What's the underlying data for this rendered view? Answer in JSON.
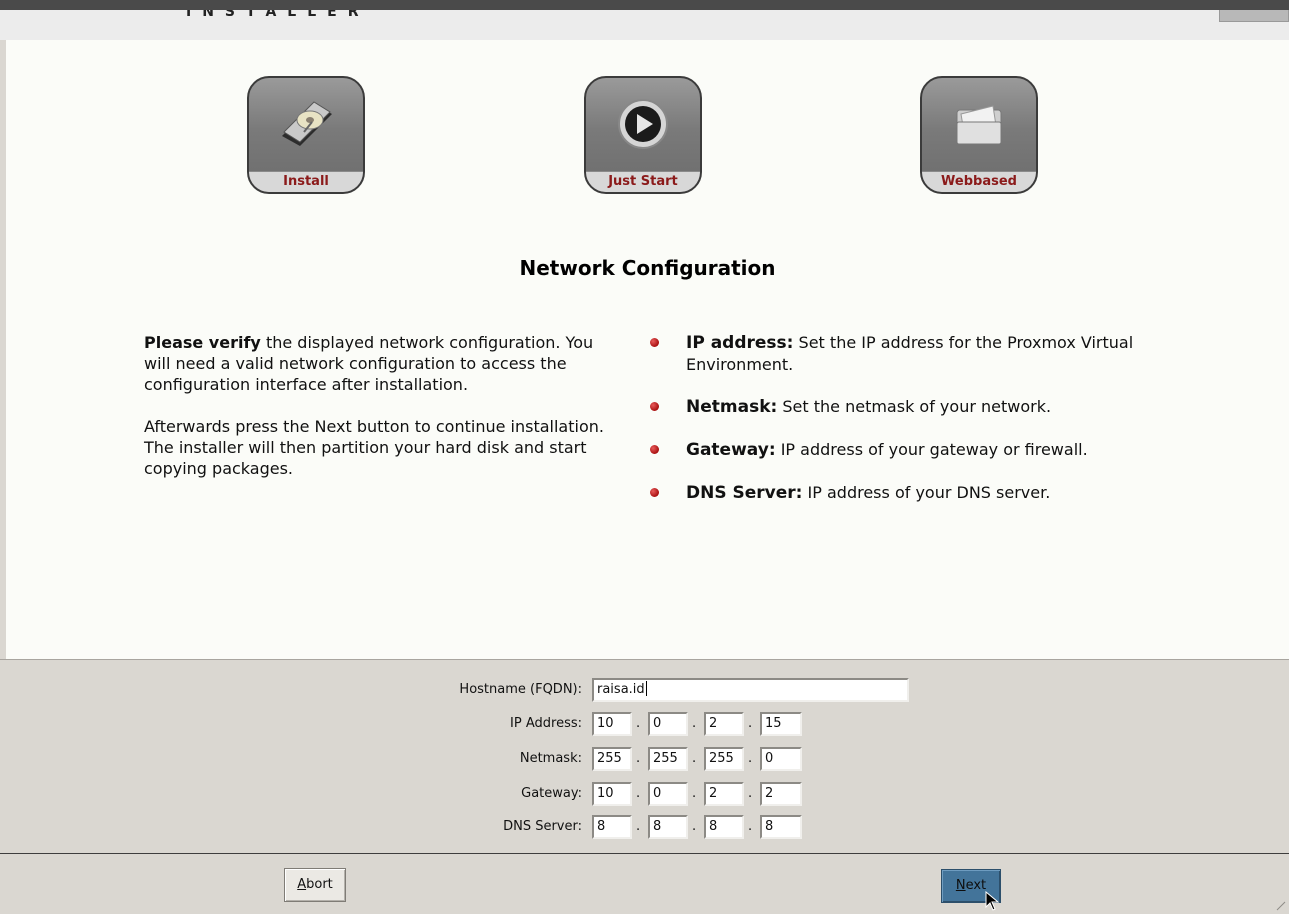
{
  "header": {
    "brand": "INSTALLER"
  },
  "icons": [
    {
      "label": "Install",
      "icon": "hard-disk-icon"
    },
    {
      "label": "Just Start",
      "icon": "play-icon"
    },
    {
      "label": "Webbased",
      "icon": "folder-icon"
    }
  ],
  "main": {
    "title": "Network Configuration",
    "intro_bold": "Please verify",
    "intro_rest": " the displayed network configuration. You will need a valid network configuration to access the configuration interface after installation.",
    "afterwards": "Afterwards press the Next button to continue installation. The installer will then partition your hard disk and start copying packages.",
    "bullets": [
      {
        "term": "IP address:",
        "text": " Set the IP address for the Proxmox Virtual Environment."
      },
      {
        "term": "Netmask:",
        "text": " Set the netmask of your network."
      },
      {
        "term": "Gateway:",
        "text": " IP address of your gateway or firewall."
      },
      {
        "term": "DNS Server:",
        "text": " IP address of your DNS server."
      }
    ]
  },
  "form": {
    "hostname_label": "Hostname (FQDN):",
    "hostname_value": "raisa.id",
    "ip_label": "IP Address:",
    "ip": [
      "10",
      "0",
      "2",
      "15"
    ],
    "netmask_label": "Netmask:",
    "netmask": [
      "255",
      "255",
      "255",
      "0"
    ],
    "gateway_label": "Gateway:",
    "gateway": [
      "10",
      "0",
      "2",
      "2"
    ],
    "dns_label": "DNS Server:",
    "dns": [
      "8",
      "8",
      "8",
      "8"
    ],
    "sep": "."
  },
  "buttons": {
    "abort_first": "A",
    "abort_rest": "bort",
    "next_first": "N",
    "next_rest": "ext"
  },
  "colors": {
    "accent": "#43749a",
    "bullet": "#a81010",
    "icon_label": "#8b1a1a"
  }
}
